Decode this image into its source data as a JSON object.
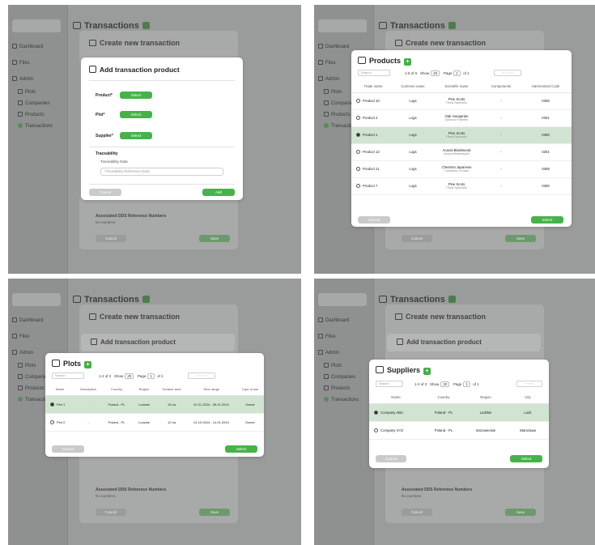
{
  "background_app": {
    "page_title": "Transactions",
    "sidebar": [
      "Dashboard",
      "Files",
      "Admin",
      "Plots",
      "Companies",
      "Products",
      "Transactions"
    ]
  },
  "create_transaction": {
    "title": "Create new transaction",
    "assoc_label": "Associated DDS Reference Numbers",
    "assoc_sub": "No numbers",
    "cancel": "Cancel",
    "save": "Save"
  },
  "add_product": {
    "title": "Add transaction product",
    "product_label": "Product*",
    "plot_label": "Plot*",
    "supplier_label": "Supplier*",
    "select": "Select",
    "traceability_label": "Traceability",
    "traceability_sub": "Traceability Data",
    "traceability_placeholder": "Traceability Reference Data",
    "cancel": "Cancel",
    "add": "Add"
  },
  "products_modal": {
    "title": "Products",
    "search_placeholder": "Search",
    "count": "1-6 of 6",
    "show": "Show",
    "show_value": "20",
    "page": "Page",
    "page_value": "1",
    "of": "of 1",
    "columns": [
      "Trade name",
      "Common name",
      "Scientific name",
      "Components",
      "Harmonized Code"
    ],
    "rows": [
      {
        "trade": "Product 10",
        "common": "Logs",
        "sci": "Pine Scots",
        "sci_sub": "Pinus Sylvestris",
        "comp": "-",
        "code": "0308",
        "selected": false
      },
      {
        "trade": "Product 2",
        "common": "Logs",
        "sci": "Oak Hungarian",
        "sci_sub": "Quercus Frainetto",
        "comp": "-",
        "code": "0301",
        "selected": false
      },
      {
        "trade": "Product 1",
        "common": "Logs",
        "sci": "Pine Scots",
        "sci_sub": "Pinus Sylvestris",
        "comp": "-",
        "code": "0306",
        "selected": true
      },
      {
        "trade": "Product 12",
        "common": "Logs",
        "sci": "Acacia Blackwood",
        "sci_sub": "Acacia Melanoxylon",
        "comp": "-",
        "code": "0301",
        "selected": false
      },
      {
        "trade": "Product 11",
        "common": "Logs",
        "sci": "Chestnut Japanese",
        "sci_sub": "Castanea Crenata",
        "comp": "-",
        "code": "0308",
        "selected": false
      },
      {
        "trade": "Product 7",
        "common": "Logs",
        "sci": "Pine Scots",
        "sci_sub": "Pinus Sylvestris",
        "comp": "-",
        "code": "0306",
        "selected": false
      }
    ],
    "cancel": "Cancel",
    "select": "Select"
  },
  "plots_modal": {
    "title": "Plots",
    "search_placeholder": "Search",
    "count": "1-2 of 2",
    "show": "Show",
    "show_value": "20",
    "page": "Page",
    "page_value": "1",
    "of": "of 1",
    "columns": [
      "Name",
      "Description",
      "Country",
      "Region",
      "Surface area",
      "Time range",
      "Type of use"
    ],
    "rows": [
      {
        "name": "Plot 1",
        "desc": "-",
        "country": "Poland - PL",
        "region": "Lodzkie",
        "area": "15 ha",
        "range": "01.01.2024 - 05.01.2024",
        "use": "Owner",
        "selected": true
      },
      {
        "name": "Plot 2",
        "desc": "-",
        "country": "Poland - PL",
        "region": "Lodzkie",
        "area": "12 ha",
        "range": "01.10.2024 - 14.01.2024",
        "use": "Owner",
        "selected": false
      }
    ],
    "cancel": "Cancel",
    "select": "Select"
  },
  "suppliers_modal": {
    "title": "Suppliers",
    "search_placeholder": "Search",
    "count": "1-2 of 2",
    "show": "Show",
    "show_value": "20",
    "page": "Page",
    "page_value": "1",
    "of": "of 1",
    "columns": [
      "Name",
      "Country",
      "Region",
      "City"
    ],
    "rows": [
      {
        "name": "Company ABC",
        "country": "Poland - PL",
        "region": "Lodzkie",
        "city": "Lodz",
        "selected": true
      },
      {
        "name": "Company XYZ",
        "country": "Poland - PL",
        "region": "mazowieckie",
        "city": "Warszawa",
        "selected": false
      }
    ],
    "cancel": "Cancel",
    "select": "Select"
  },
  "colors": {
    "overlay": "#9a9b9b",
    "accent": "#46b34a",
    "selected_row": "#d1e4d1"
  }
}
